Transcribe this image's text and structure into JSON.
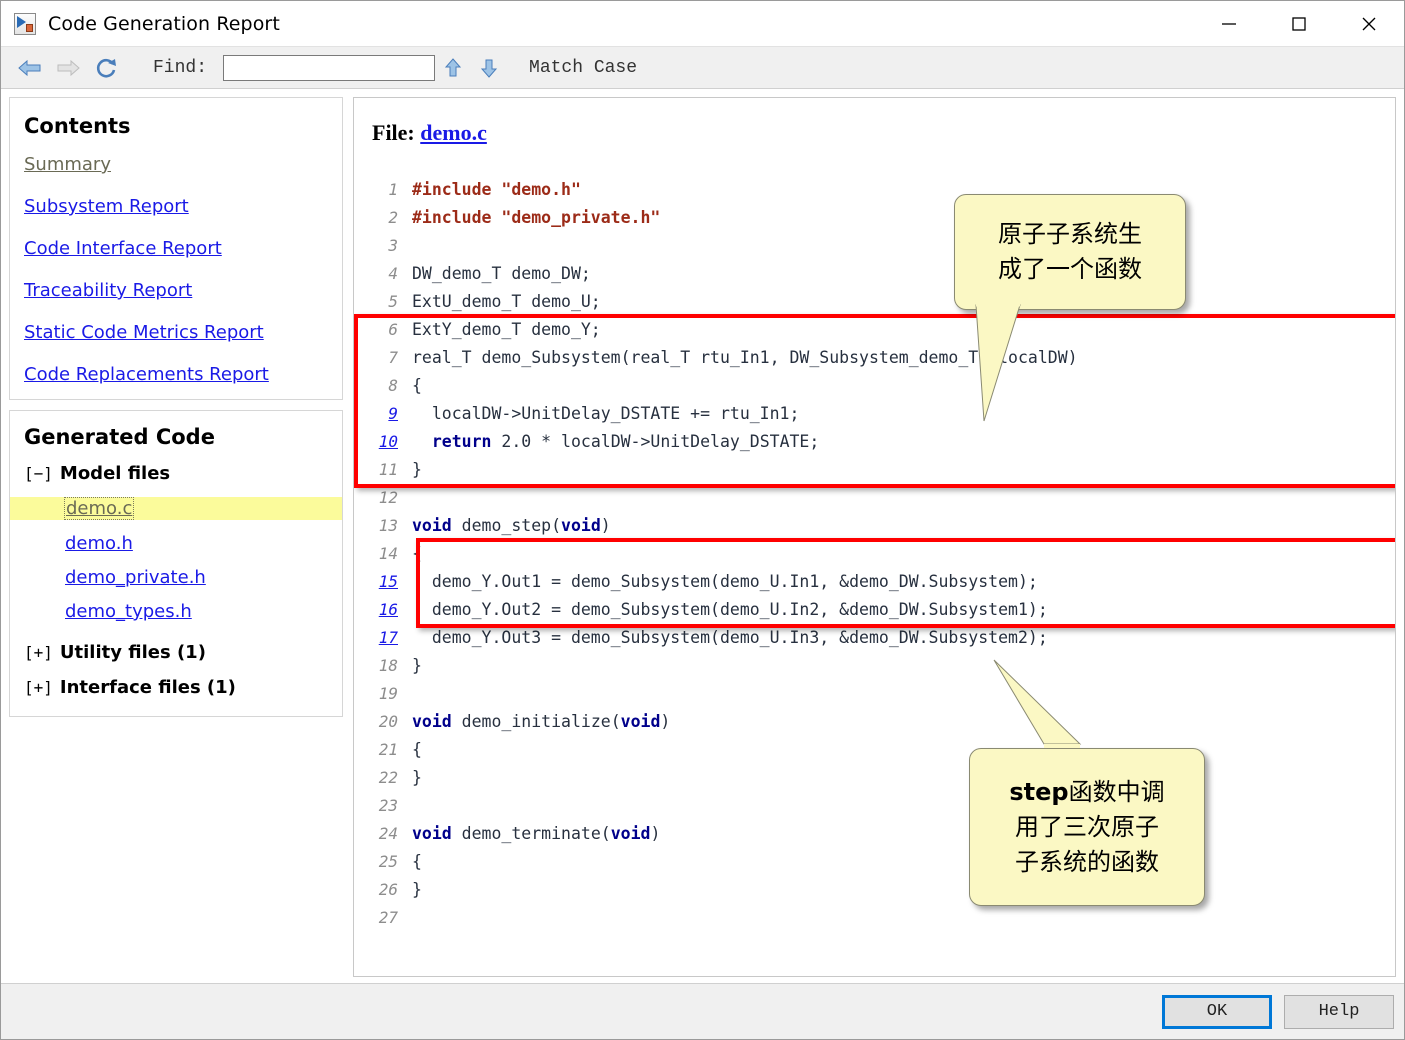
{
  "window": {
    "title": "Code Generation Report",
    "app_icon": "report-icon",
    "minimize_label": "—",
    "maximize_label": "☐",
    "close_label": "✕"
  },
  "toolbar": {
    "back_icon": "back-arrow-icon",
    "forward_icon": "forward-arrow-icon",
    "refresh_icon": "refresh-icon",
    "find_label": "Find:",
    "find_value": "",
    "find_placeholder": "",
    "find_prev_icon": "up-arrow-icon",
    "find_next_icon": "down-arrow-icon",
    "match_case_label": "Match Case"
  },
  "sidebar": {
    "contents_title": "Contents",
    "toc": [
      {
        "label": "Summary",
        "state": "visited"
      },
      {
        "label": "Subsystem Report",
        "state": "link"
      },
      {
        "label": "Code Interface Report",
        "state": "link"
      },
      {
        "label": "Traceability Report",
        "state": "link"
      },
      {
        "label": "Static Code Metrics Report",
        "state": "link"
      },
      {
        "label": "Code Replacements Report",
        "state": "link"
      }
    ],
    "generated_code_title": "Generated Code",
    "tree": {
      "model_files": {
        "toggle": "[−]",
        "label": "Model files"
      },
      "files": [
        {
          "label": "demo.c",
          "selected": true
        },
        {
          "label": "demo.h",
          "selected": false
        },
        {
          "label": "demo_private.h",
          "selected": false
        },
        {
          "label": "demo_types.h",
          "selected": false
        }
      ],
      "utility_files": {
        "toggle": "[+]",
        "label": "Utility files (1)"
      },
      "interface_files": {
        "toggle": "[+]",
        "label": "Interface files (1)"
      }
    }
  },
  "content": {
    "file_prefix": "File:",
    "file_name": "demo.c",
    "lines": [
      {
        "n": "1",
        "link": false,
        "tokens": [
          {
            "t": "#include ",
            "c": "pre"
          },
          {
            "t": "\"demo.h\"",
            "c": "pre"
          }
        ]
      },
      {
        "n": "2",
        "link": false,
        "tokens": [
          {
            "t": "#include ",
            "c": "pre"
          },
          {
            "t": "\"demo_private.h\"",
            "c": "pre"
          }
        ]
      },
      {
        "n": "3",
        "link": false,
        "tokens": [
          {
            "t": "",
            "c": "ctext"
          }
        ]
      },
      {
        "n": "4",
        "link": false,
        "tokens": [
          {
            "t": "DW_demo_T demo_DW;",
            "c": "ctext"
          }
        ]
      },
      {
        "n": "5",
        "link": false,
        "tokens": [
          {
            "t": "ExtU_demo_T demo_U;",
            "c": "ctext"
          }
        ]
      },
      {
        "n": "6",
        "link": false,
        "tokens": [
          {
            "t": "ExtY_demo_T demo_Y;",
            "c": "ctext"
          }
        ]
      },
      {
        "n": "7",
        "link": false,
        "tokens": [
          {
            "t": "real_T demo_Subsystem(real_T rtu_In1, DW_Subsystem_demo_T *localDW)",
            "c": "ctext"
          }
        ]
      },
      {
        "n": "8",
        "link": false,
        "tokens": [
          {
            "t": "{",
            "c": "ctext"
          }
        ]
      },
      {
        "n": "9",
        "link": true,
        "tokens": [
          {
            "t": "  localDW->UnitDelay_DSTATE += rtu_In1;",
            "c": "ctext"
          }
        ]
      },
      {
        "n": "10",
        "link": true,
        "tokens": [
          {
            "t": "  ",
            "c": "ctext"
          },
          {
            "t": "return",
            "c": "kw"
          },
          {
            "t": " 2.0 * localDW->UnitDelay_DSTATE;",
            "c": "ctext"
          }
        ]
      },
      {
        "n": "11",
        "link": false,
        "tokens": [
          {
            "t": "}",
            "c": "ctext"
          }
        ]
      },
      {
        "n": "12",
        "link": false,
        "tokens": [
          {
            "t": "",
            "c": "ctext"
          }
        ]
      },
      {
        "n": "13",
        "link": false,
        "tokens": [
          {
            "t": "void",
            "c": "kw"
          },
          {
            "t": " demo_step(",
            "c": "ctext"
          },
          {
            "t": "void",
            "c": "kw"
          },
          {
            "t": ")",
            "c": "ctext"
          }
        ]
      },
      {
        "n": "14",
        "link": false,
        "tokens": [
          {
            "t": "{",
            "c": "ctext"
          }
        ]
      },
      {
        "n": "15",
        "link": true,
        "tokens": [
          {
            "t": "  demo_Y.Out1 = demo_Subsystem(demo_U.In1, &demo_DW.Subsystem);",
            "c": "ctext"
          }
        ]
      },
      {
        "n": "16",
        "link": true,
        "tokens": [
          {
            "t": "  demo_Y.Out2 = demo_Subsystem(demo_U.In2, &demo_DW.Subsystem1);",
            "c": "ctext"
          }
        ]
      },
      {
        "n": "17",
        "link": true,
        "tokens": [
          {
            "t": "  demo_Y.Out3 = demo_Subsystem(demo_U.In3, &demo_DW.Subsystem2);",
            "c": "ctext"
          }
        ]
      },
      {
        "n": "18",
        "link": false,
        "tokens": [
          {
            "t": "}",
            "c": "ctext"
          }
        ]
      },
      {
        "n": "19",
        "link": false,
        "tokens": [
          {
            "t": "",
            "c": "ctext"
          }
        ]
      },
      {
        "n": "20",
        "link": false,
        "tokens": [
          {
            "t": "void",
            "c": "kw"
          },
          {
            "t": " demo_initialize(",
            "c": "ctext"
          },
          {
            "t": "void",
            "c": "kw"
          },
          {
            "t": ")",
            "c": "ctext"
          }
        ]
      },
      {
        "n": "21",
        "link": false,
        "tokens": [
          {
            "t": "{",
            "c": "ctext"
          }
        ]
      },
      {
        "n": "22",
        "link": false,
        "tokens": [
          {
            "t": "}",
            "c": "ctext"
          }
        ]
      },
      {
        "n": "23",
        "link": false,
        "tokens": [
          {
            "t": "",
            "c": "ctext"
          }
        ]
      },
      {
        "n": "24",
        "link": false,
        "tokens": [
          {
            "t": "void",
            "c": "kw"
          },
          {
            "t": " demo_terminate(",
            "c": "ctext"
          },
          {
            "t": "void",
            "c": "kw"
          },
          {
            "t": ")",
            "c": "ctext"
          }
        ]
      },
      {
        "n": "25",
        "link": false,
        "tokens": [
          {
            "t": "{",
            "c": "ctext"
          }
        ]
      },
      {
        "n": "26",
        "link": false,
        "tokens": [
          {
            "t": "}",
            "c": "ctext"
          }
        ]
      },
      {
        "n": "27",
        "link": false,
        "tokens": [
          {
            "t": "",
            "c": "ctext"
          }
        ]
      }
    ]
  },
  "annotations": {
    "highlight_color": "#ff0000",
    "callout_bg": "#fbf8c4",
    "callout1": {
      "line1": "原子子系统生",
      "line2": "成了一个函数"
    },
    "callout2": {
      "line1_bold": "step",
      "line1_rest": "函数中调",
      "line2": "用了三次原子",
      "line3": "子系统的函数"
    }
  },
  "footer": {
    "ok_label": "OK",
    "help_label": "Help"
  }
}
